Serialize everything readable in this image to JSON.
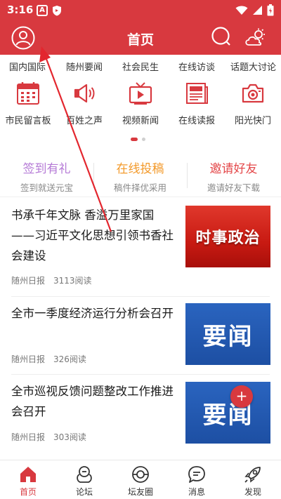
{
  "status_bar": {
    "time": "3:16",
    "app_badge": "A"
  },
  "header": {
    "title": "首页"
  },
  "channels": [
    "国内国际",
    "随州要闻",
    "社会民生",
    "在线访谈",
    "话题大讨论"
  ],
  "grid": [
    {
      "label": "市民留言板",
      "icon": "calendar-icon"
    },
    {
      "label": "百姓之声",
      "icon": "megaphone-icon"
    },
    {
      "label": "视频新闻",
      "icon": "tv-icon"
    },
    {
      "label": "在线读报",
      "icon": "newspaper-icon"
    },
    {
      "label": "阳光快门",
      "icon": "camera-icon"
    }
  ],
  "features": [
    {
      "title": "签到有礼",
      "subtitle": "签到就送元宝",
      "color": "#b57ad6"
    },
    {
      "title": "在线投稿",
      "subtitle": "稿件择优采用",
      "color": "#f39a2b"
    },
    {
      "title": "邀请好友",
      "subtitle": "邀请好友下载",
      "color": "#e4484a"
    }
  ],
  "articles": [
    {
      "title": "书承千年文脉 香溢万里家国——习近平文化思想引领书香社会建设",
      "source": "随州日报",
      "reads": "3113阅读",
      "thumb_text": "时事政治",
      "thumb_style": "red"
    },
    {
      "title": "全市一季度经济运行分析会召开",
      "source": "随州日报",
      "reads": "326阅读",
      "thumb_text": "要闻",
      "thumb_style": "blue"
    },
    {
      "title": "全市巡视反馈问题整改工作推进会召开",
      "source": "随州日报",
      "reads": "303阅读",
      "thumb_text": "要闻",
      "thumb_style": "blue"
    }
  ],
  "fab": {
    "label": "+"
  },
  "bottom_nav": [
    {
      "label": "首页",
      "icon": "home-icon",
      "active": true
    },
    {
      "label": "论坛",
      "icon": "forum-icon",
      "active": false
    },
    {
      "label": "坛友圈",
      "icon": "circle-icon",
      "active": false
    },
    {
      "label": "消息",
      "icon": "message-icon",
      "active": false
    },
    {
      "label": "发现",
      "icon": "rocket-icon",
      "active": false
    }
  ],
  "colors": {
    "brand": "#d8393f",
    "annotation_arrow": "#e3262e"
  }
}
